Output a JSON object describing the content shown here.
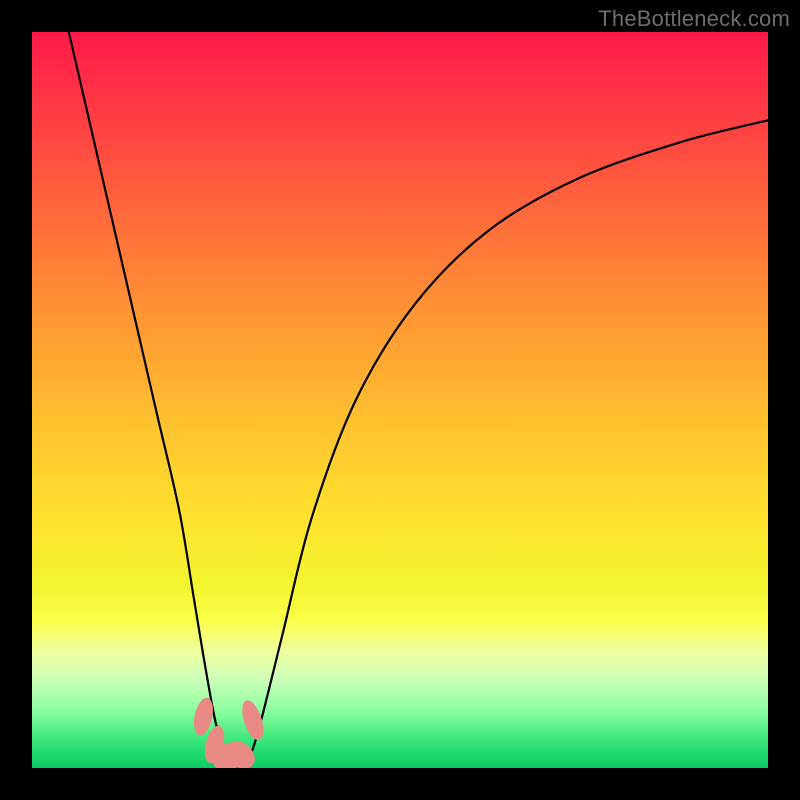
{
  "watermark": "TheBottleneck.com",
  "chart_data": {
    "type": "line",
    "title": "",
    "xlabel": "",
    "ylabel": "",
    "xlim": [
      0,
      100
    ],
    "ylim": [
      0,
      100
    ],
    "series": [
      {
        "name": "bottleneck-curve",
        "x": [
          5,
          8,
          11,
          14,
          17,
          20,
          22,
          23.5,
          25,
          26.5,
          28,
          29.5,
          31,
          34,
          38,
          44,
          52,
          62,
          74,
          88,
          100
        ],
        "y": [
          100,
          87,
          74,
          61,
          48,
          35,
          23,
          14,
          6,
          1.5,
          0.5,
          1.5,
          6,
          18,
          34,
          50,
          63,
          73,
          80,
          85,
          88
        ]
      }
    ],
    "markers": {
      "name": "highlight-dots",
      "color": "#e98b84",
      "points": [
        {
          "x": 23.3,
          "y": 7.0,
          "rx": 1.2,
          "ry": 2.6,
          "rot": 12
        },
        {
          "x": 24.8,
          "y": 3.2,
          "rx": 1.2,
          "ry": 2.6,
          "rot": 14
        },
        {
          "x": 26.6,
          "y": 1.5,
          "rx": 1.8,
          "ry": 2.2,
          "rot": 60
        },
        {
          "x": 28.3,
          "y": 1.8,
          "rx": 1.6,
          "ry": 2.2,
          "rot": -50
        },
        {
          "x": 30.0,
          "y": 6.5,
          "rx": 1.2,
          "ry": 2.8,
          "rot": -18
        }
      ]
    },
    "gradient_stops": [
      {
        "pos": 0,
        "color": "#ff1a49"
      },
      {
        "pos": 25,
        "color": "#ff6a3b"
      },
      {
        "pos": 52,
        "color": "#ffbe2f"
      },
      {
        "pos": 75,
        "color": "#f3f52f"
      },
      {
        "pos": 100,
        "color": "#0fc965"
      }
    ]
  }
}
